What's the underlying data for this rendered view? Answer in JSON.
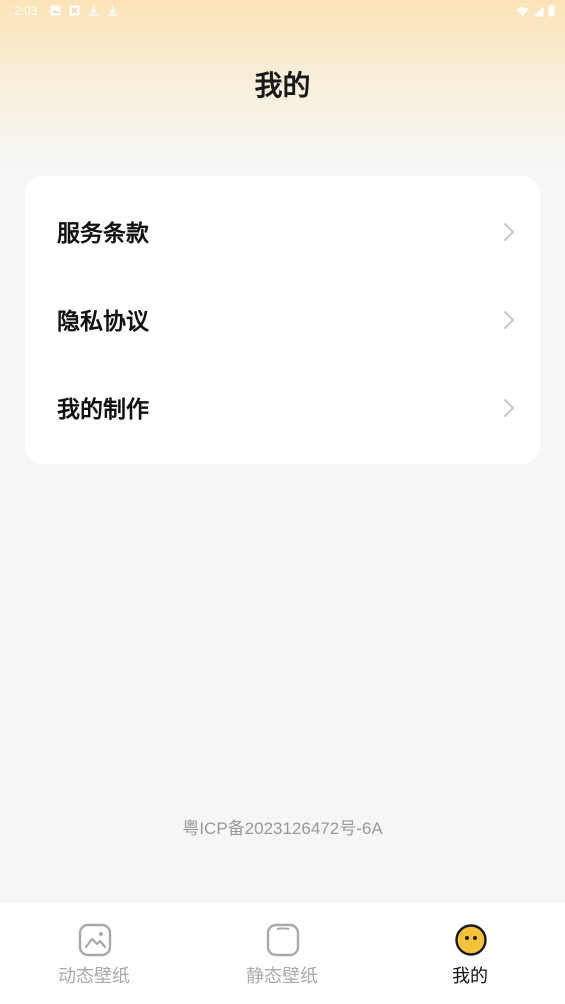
{
  "status_bar": {
    "time": "2:03"
  },
  "header": {
    "title": "我的"
  },
  "menu": {
    "items": [
      {
        "label": "服务条款"
      },
      {
        "label": "隐私协议"
      },
      {
        "label": "我的制作"
      }
    ]
  },
  "footer": {
    "icp": "粤ICP备2023126472号-6A"
  },
  "bottom_nav": {
    "tabs": [
      {
        "label": "动态壁纸",
        "icon": "image-icon",
        "active": false
      },
      {
        "label": "静态壁纸",
        "icon": "square-icon",
        "active": false
      },
      {
        "label": "我的",
        "icon": "face-icon",
        "active": true
      }
    ]
  },
  "colors": {
    "accent": "#f5c33b",
    "header_gradient_top": "#fbe3b6",
    "background": "#f6f6f6"
  }
}
